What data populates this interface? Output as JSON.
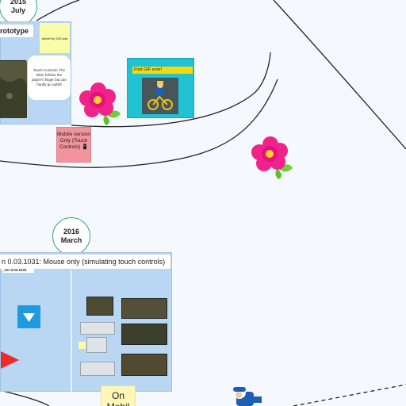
{
  "dates": [
    {
      "year": "2015",
      "month": "July"
    },
    {
      "year": "2016",
      "month": "March"
    }
  ],
  "card_2015": {
    "title": "rototype",
    "sticky_text": "#level%d_002.pak",
    "note_text": "Touch Controls: The biker follows the player's finger but can hardly go uphill!"
  },
  "gif_card": {
    "label": "First GIF ever!"
  },
  "mobile_sticky": {
    "text": "Mobile version Only (Touch Controls) 📱"
  },
  "card_2016": {
    "title": "n 0.03.1031: Mouse only (simulating touch controls)",
    "subtitle": "_ver 0.03.1031"
  },
  "on_mobile_sticky": {
    "text": "On Mobil"
  },
  "colors": {
    "background": "#f5f9fd",
    "card": "#b9d6f2",
    "date_border": "#2fa37c",
    "teal_card": "#1fc3d3",
    "flower": "#f0208a",
    "blue_button": "#1e9be0",
    "red_arrow": "#ee2b2b"
  },
  "icons": [
    "flower-icon",
    "flower-icon",
    "down-arrow-icon",
    "right-arrow-icon",
    "biker-figure-icon"
  ]
}
